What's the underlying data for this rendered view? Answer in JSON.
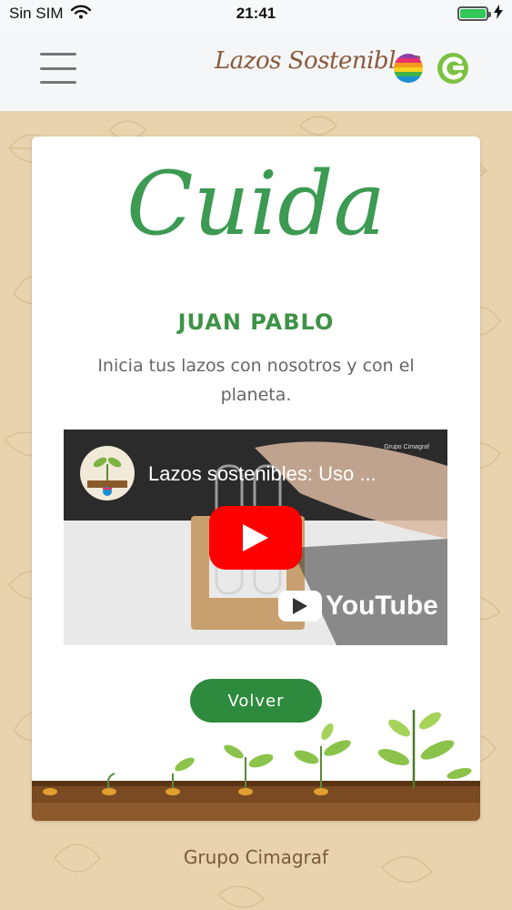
{
  "status_bar": {
    "carrier": "Sin SIM",
    "time": "21:41",
    "battery_percent": 100
  },
  "header": {
    "brand": "Lazos Sostenibles",
    "icons": [
      "menu-icon",
      "globe-icon",
      "c-logo-icon"
    ]
  },
  "card": {
    "script_title": "Cuida",
    "user_name": "JUAN PABLO",
    "tagline": "Inicia tus lazos con nosotros y con el planeta.",
    "video": {
      "title": "Lazos sostenibles: Uso ...",
      "channel_label": "Grupo Cimagraf",
      "platform": "YouTube"
    },
    "back_button": "Volver"
  },
  "footer": {
    "text": "Grupo Cimagraf"
  },
  "colors": {
    "accent_green": "#2e8b3e",
    "title_green": "#3c9a52",
    "background_kraft": "#e8d3ae",
    "youtube_red": "#ff0000"
  }
}
